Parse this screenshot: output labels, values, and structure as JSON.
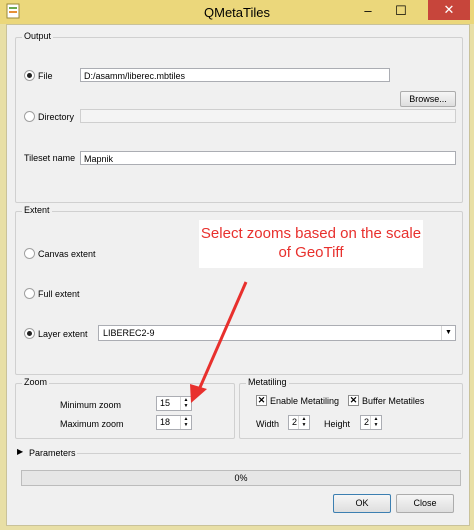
{
  "window": {
    "title": "QMetaTiles",
    "minimize_glyph": "–",
    "maximize_glyph": "☐",
    "close_glyph": "✕"
  },
  "output": {
    "legend": "Output",
    "file_label": "File",
    "file_value": "D:/asamm/liberec.mbtiles",
    "browse_label": "Browse...",
    "directory_label": "Directory",
    "directory_value": "",
    "tileset_label": "Tileset name",
    "tileset_value": "Mapnik",
    "selected": "file"
  },
  "extent": {
    "legend": "Extent",
    "canvas_label": "Canvas extent",
    "full_label": "Full extent",
    "layer_label": "Layer extent",
    "layer_value": "LIBEREC2-9",
    "selected": "layer"
  },
  "annotation": {
    "text": "Select zooms based on the scale of GeoTiff",
    "color": "#e8302d"
  },
  "zoom": {
    "legend": "Zoom",
    "min_label": "Minimum zoom",
    "min_value": "15",
    "max_label": "Maximum zoom",
    "max_value": "18"
  },
  "metatiling": {
    "legend": "Metatiling",
    "enable_label": "Enable Metatiling",
    "enable_checked": true,
    "buffer_label": "Buffer Metatiles",
    "buffer_checked": true,
    "width_label": "Width",
    "width_value": "2",
    "height_label": "Height",
    "height_value": "2"
  },
  "parameters": {
    "label": "Parameters"
  },
  "progress": {
    "text": "0%",
    "value": 0
  },
  "buttons": {
    "ok": "OK",
    "close": "Close"
  },
  "icons": {
    "app": "qgis-tiles-icon",
    "expand": "triangle-right-icon"
  }
}
